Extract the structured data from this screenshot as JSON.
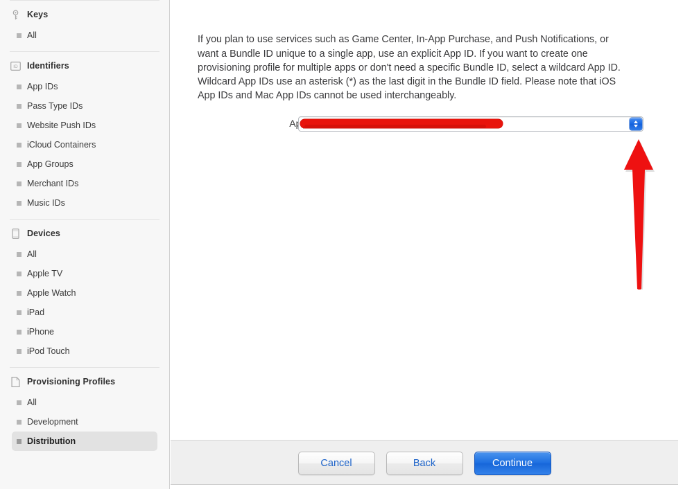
{
  "sidebar": {
    "sections": [
      {
        "title": "Keys",
        "icon": "key-icon",
        "items": [
          {
            "label": "All",
            "selected": false
          }
        ]
      },
      {
        "title": "Identifiers",
        "icon": "id-badge-icon",
        "items": [
          {
            "label": "App IDs",
            "selected": false
          },
          {
            "label": "Pass Type IDs",
            "selected": false
          },
          {
            "label": "Website Push IDs",
            "selected": false
          },
          {
            "label": "iCloud Containers",
            "selected": false
          },
          {
            "label": "App Groups",
            "selected": false
          },
          {
            "label": "Merchant IDs",
            "selected": false
          },
          {
            "label": "Music IDs",
            "selected": false
          }
        ]
      },
      {
        "title": "Devices",
        "icon": "device-icon",
        "items": [
          {
            "label": "All",
            "selected": false
          },
          {
            "label": "Apple TV",
            "selected": false
          },
          {
            "label": "Apple Watch",
            "selected": false
          },
          {
            "label": "iPad",
            "selected": false
          },
          {
            "label": "iPhone",
            "selected": false
          },
          {
            "label": "iPod Touch",
            "selected": false
          }
        ]
      },
      {
        "title": "Provisioning Profiles",
        "icon": "document-icon",
        "items": [
          {
            "label": "All",
            "selected": false
          },
          {
            "label": "Development",
            "selected": false
          },
          {
            "label": "Distribution",
            "selected": true
          }
        ]
      }
    ]
  },
  "main": {
    "intro_paragraph": "If you plan to use services such as Game Center, In-App Purchase, and Push Notifications, or want a Bundle ID unique to a single app, use an explicit App ID. If you want to create one provisioning profile for multiple apps or don't need a specific Bundle ID, select a wildcard App ID. Wildcard App IDs use an asterisk (*) as the last digit in the Bundle ID field. Please note that iOS App IDs and Mac App IDs cannot be used interchangeably.",
    "app_id_field": {
      "label": "App ID:",
      "value": ")",
      "redacted": true,
      "stepper_icon": "updown-chevron-icon"
    }
  },
  "annotation": {
    "arrow_icon": "red-up-arrow-icon",
    "color": "#ee1111"
  },
  "footer": {
    "cancel_label": "Cancel",
    "back_label": "Back",
    "continue_label": "Continue",
    "primary_color": "#1d6fe0"
  }
}
